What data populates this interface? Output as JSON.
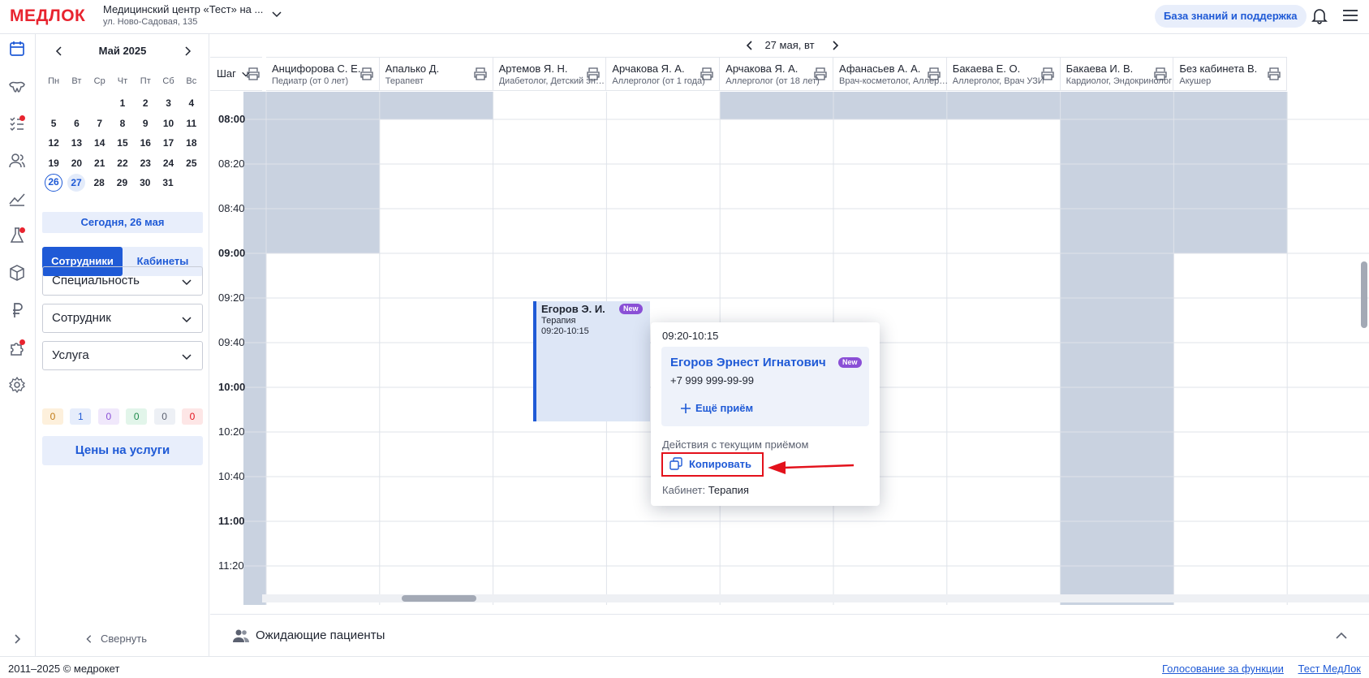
{
  "header": {
    "logo_text": "МЕДЛОК",
    "clinic_name": "Медицинский центр «Тест» на ...",
    "clinic_address": "ул. Ново-Садовая, 135",
    "knowledge_base_label": "База знаний и поддержка"
  },
  "calendar": {
    "title": "Май 2025",
    "weekdays": [
      "Пн",
      "Вт",
      "Ср",
      "Чт",
      "Пт",
      "Сб",
      "Вс"
    ],
    "weeks": [
      [
        "",
        "",
        "",
        "1",
        "2",
        "3",
        "4"
      ],
      [
        "5",
        "6",
        "7",
        "8",
        "9",
        "10",
        "11"
      ],
      [
        "12",
        "13",
        "14",
        "15",
        "16",
        "17",
        "18"
      ],
      [
        "19",
        "20",
        "21",
        "22",
        "23",
        "24",
        "25"
      ],
      [
        "26",
        "27",
        "28",
        "29",
        "30",
        "31",
        ""
      ]
    ],
    "today_label": "Сегодня, 26 мая"
  },
  "tabs": {
    "staff": "Сотрудники",
    "rooms": "Кабинеты"
  },
  "filters": {
    "specialty": "Специальность",
    "employee": "Сотрудник",
    "service": "Услуга"
  },
  "counters": [
    {
      "value": "0",
      "bg": "#fdf0dc",
      "fg": "#c07a14"
    },
    {
      "value": "1",
      "bg": "#e6edfb",
      "fg": "#1f5ad6"
    },
    {
      "value": "0",
      "bg": "#f0e8fb",
      "fg": "#8a4fd6"
    },
    {
      "value": "0",
      "bg": "#e2f5ea",
      "fg": "#1f8a4c"
    },
    {
      "value": "0",
      "bg": "#edf0f5",
      "fg": "#5b6170"
    },
    {
      "value": "0",
      "bg": "#fde6e6",
      "fg": "#e3111b"
    }
  ],
  "prices_label": "Цены на услуги",
  "collapse_label": "Свернуть",
  "schedule": {
    "date_label": "27 мая, вт",
    "step_label": "Шаг",
    "columns": [
      {
        "name": "Анцифорова С. Е.",
        "spec": "Педиатр (от 0 лет)"
      },
      {
        "name": "Апалько Д.",
        "spec": "Терапевт"
      },
      {
        "name": "Артемов Я. Н.",
        "spec": "Диабетолог, Детский эндокринолог"
      },
      {
        "name": "Арчакова Я. А.",
        "spec": "Аллерголог (от 1 года)"
      },
      {
        "name": "Арчакова Я. А.",
        "spec": "Аллерголог (от 18 лет)"
      },
      {
        "name": "Афанасьев А. А.",
        "spec": "Врач-косметолог, Аллерголог"
      },
      {
        "name": "Бакаева Е. О.",
        "spec": "Аллерголог, Врач УЗИ"
      },
      {
        "name": "Бакаева И. В.",
        "spec": "Кардиолог, Эндокринолог"
      },
      {
        "name": "Без кабинета В.",
        "spec": "Акушер"
      }
    ],
    "times": [
      {
        "t": "08:00",
        "bold": true
      },
      {
        "t": "08:20",
        "bold": false
      },
      {
        "t": "08:40",
        "bold": false
      },
      {
        "t": "09:00",
        "bold": true
      },
      {
        "t": "09:20",
        "bold": false
      },
      {
        "t": "09:40",
        "bold": false
      },
      {
        "t": "10:00",
        "bold": true
      },
      {
        "t": "10:20",
        "bold": false
      },
      {
        "t": "10:40",
        "bold": false
      },
      {
        "t": "11:00",
        "bold": true
      },
      {
        "t": "11:20",
        "bold": false
      }
    ]
  },
  "appointment": {
    "patient_short": "Егоров Э. И.",
    "service": "Терапия",
    "time": "09:20-10:15",
    "badge": "New"
  },
  "popup": {
    "time": "09:20-10:15",
    "patient_full": "Егоров Эрнест Игнатович",
    "badge": "New",
    "phone": "+7 999 999-99-99",
    "more_label": "Ещё приём",
    "actions_title": "Действия с текущим приёмом",
    "copy_label": "Копировать",
    "cabinet_label": "Кабинет:",
    "cabinet_value": "Терапия"
  },
  "waiting": {
    "label": "Ожидающие пациенты"
  },
  "footer": {
    "copyright": "2011–2025 © медрокет",
    "link_voting": "Голосование за функции",
    "link_test": "Тест МедЛок"
  },
  "colors": {
    "accent": "#1f5ad6",
    "offhours": "#c9d2e0",
    "highlight": "#e3111b"
  }
}
